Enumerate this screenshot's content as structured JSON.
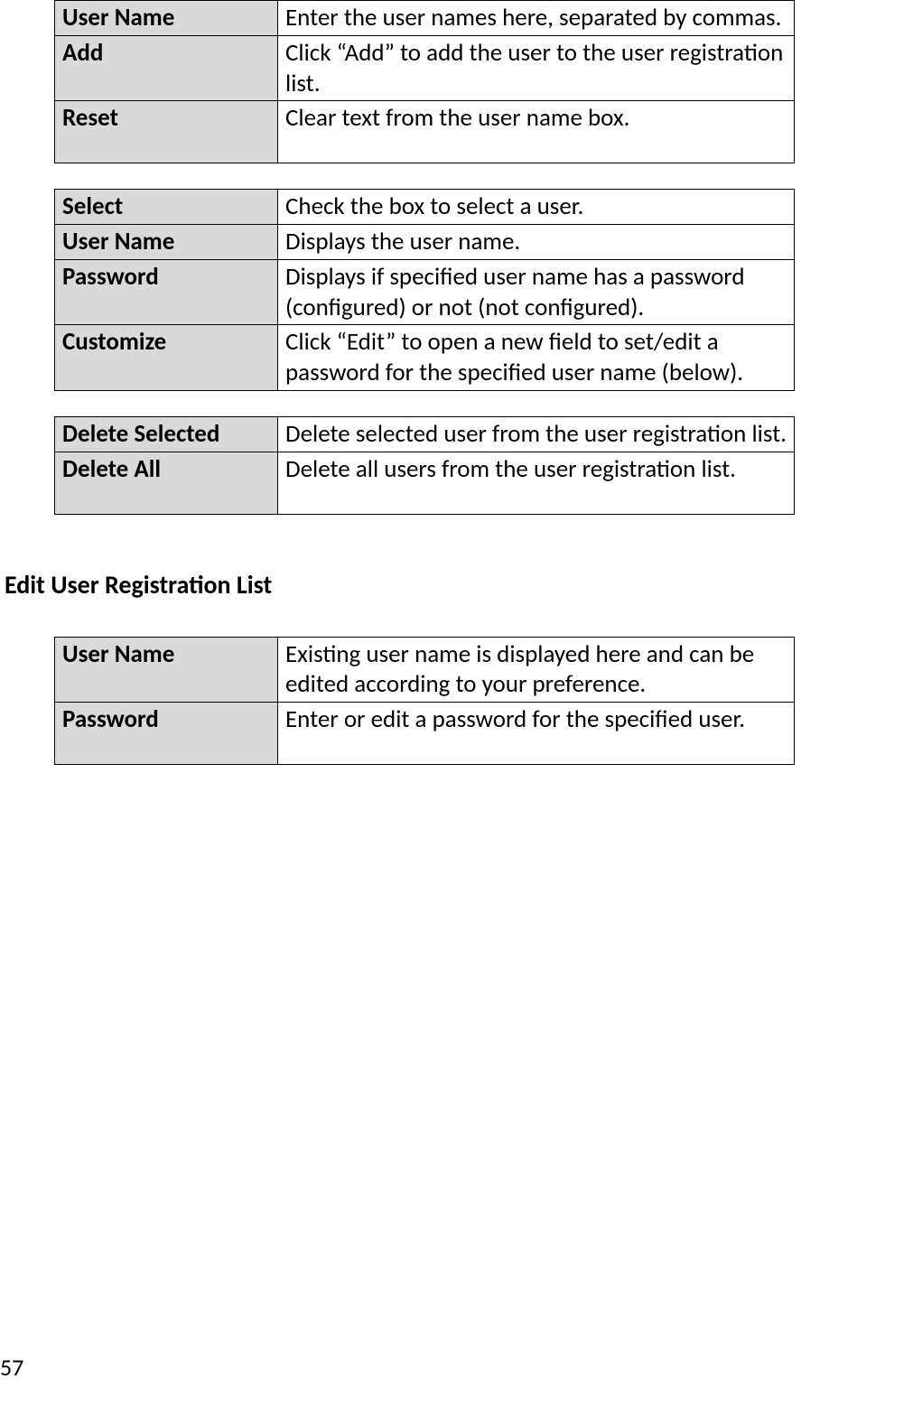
{
  "table1": {
    "rows": [
      {
        "term": "User Name",
        "desc": "Enter the user names here, separated by commas."
      },
      {
        "term": "Add",
        "desc": "Click “Add” to add the user to the user registration list."
      },
      {
        "term": "Reset",
        "desc": "Clear text from the user name box."
      }
    ]
  },
  "table2": {
    "rows": [
      {
        "term": "Select",
        "desc": "Check the box to select a user."
      },
      {
        "term": "User Name",
        "desc": "Displays the user name."
      },
      {
        "term": "Password",
        "desc": "Displays if specified user name has a password (configured) or not (not configured)."
      },
      {
        "term": "Customize",
        "desc": "Click “Edit” to open a new field to set/edit a password for the specified user name (below)."
      }
    ]
  },
  "table3": {
    "rows": [
      {
        "term": "Delete Selected",
        "desc": "Delete selected user from the user registration list."
      },
      {
        "term": "Delete All",
        "desc": "Delete all users from the user registration list."
      }
    ]
  },
  "section_heading": "Edit User Registration List",
  "table4": {
    "rows": [
      {
        "term": "User Name",
        "desc": "Existing user name is displayed here and can be edited according to your preference."
      },
      {
        "term": "Password",
        "desc": "Enter or edit a password for the specified user."
      }
    ]
  },
  "page_number": "57"
}
